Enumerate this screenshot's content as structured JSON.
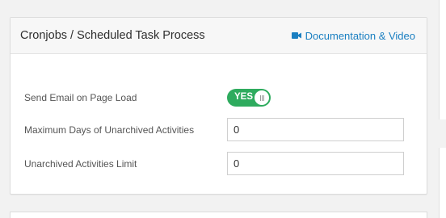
{
  "panel": {
    "title": "Cronjobs / Scheduled Task Process",
    "doc_link_label": "Documentation & Video",
    "doc_link_icon": "video-camera-icon",
    "accent_color": "#1a7fc1"
  },
  "settings": {
    "send_email": {
      "label": "Send Email on Page Load",
      "toggle_text": "YES",
      "enabled": true,
      "toggle_color": "#2eab5e"
    },
    "max_days": {
      "label": "Maximum Days of Unarchived Activities",
      "value": "0"
    },
    "activities_limit": {
      "label": "Unarchived Activities Limit",
      "value": "0"
    }
  }
}
